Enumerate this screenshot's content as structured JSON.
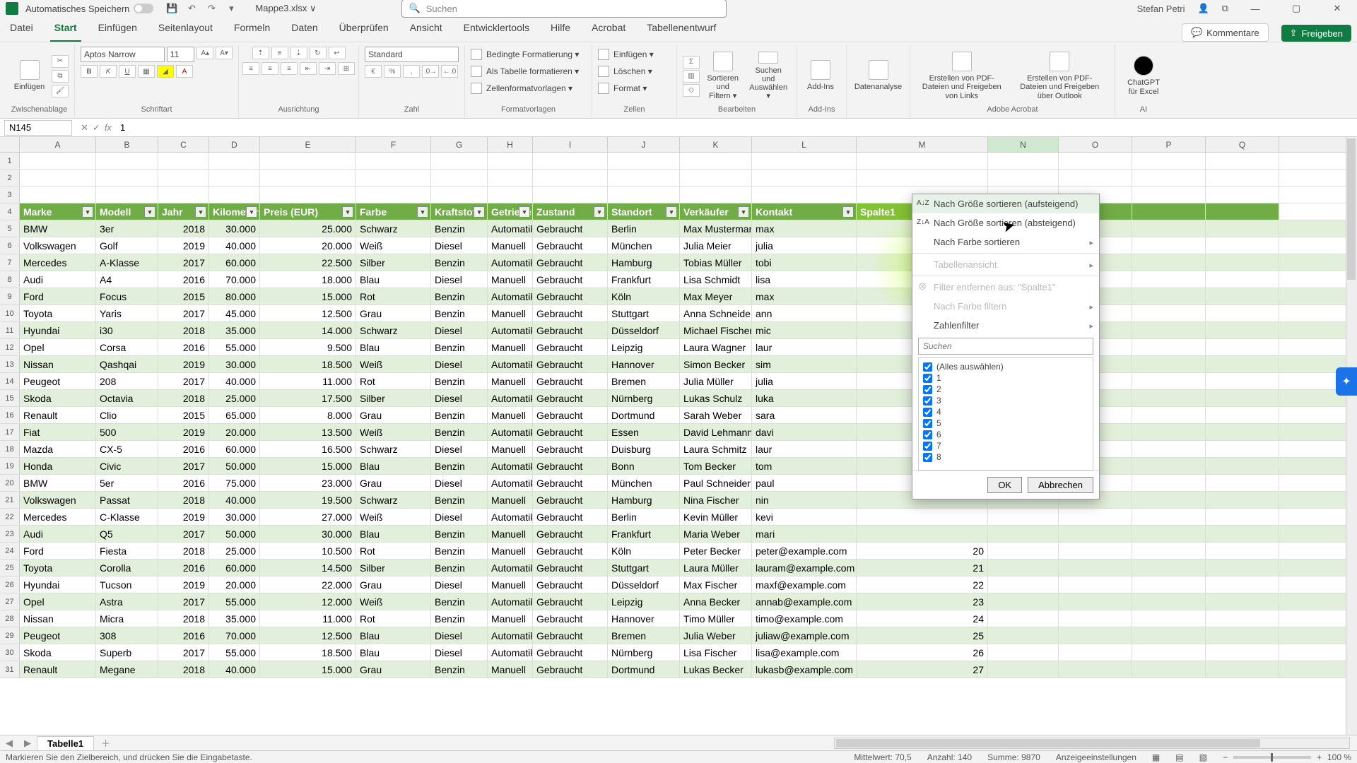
{
  "titlebar": {
    "autosave_label": "Automatisches Speichern",
    "filename": "Mappe3.xlsx ∨",
    "search_placeholder": "Suchen",
    "user": "Stefan Petri"
  },
  "tabs": {
    "items": [
      "Datei",
      "Start",
      "Einfügen",
      "Seitenlayout",
      "Formeln",
      "Daten",
      "Überprüfen",
      "Ansicht",
      "Entwicklertools",
      "Hilfe",
      "Acrobat",
      "Tabellenentwurf"
    ],
    "active_index": 1,
    "comments": "Kommentare",
    "share": "Freigeben"
  },
  "ribbon": {
    "clipboard": {
      "paste": "Einfügen",
      "label": "Zwischenablage"
    },
    "font": {
      "name": "Aptos Narrow",
      "size": "11",
      "label": "Schriftart"
    },
    "align": {
      "label": "Ausrichtung"
    },
    "number": {
      "format": "Standard",
      "label": "Zahl"
    },
    "styles": {
      "cond": "Bedingte Formatierung ▾",
      "tbl": "Als Tabelle formatieren ▾",
      "cell": "Zellenformatvorlagen ▾",
      "label": "Formatvorlagen"
    },
    "cells": {
      "ins": "Einfügen ▾",
      "del": "Löschen ▾",
      "fmt": "Format ▾",
      "label": "Zellen"
    },
    "edit": {
      "sort": "Sortieren und Filtern ▾",
      "find": "Suchen und Auswählen ▾",
      "label": "Bearbeiten"
    },
    "addins": {
      "btn": "Add-Ins",
      "label": "Add-Ins"
    },
    "data": {
      "btn": "Datenanalyse"
    },
    "acrobat": {
      "a": "Erstellen von PDF-Dateien und Freigeben von Links",
      "b": "Erstellen von PDF-Dateien und Freigeben über Outlook",
      "label": "Adobe Acrobat"
    },
    "ai": {
      "btn": "ChatGPT für Excel",
      "label": "AI"
    }
  },
  "formula_bar": {
    "namebox": "N145",
    "value": "1"
  },
  "columns": {
    "letters": [
      "A",
      "B",
      "C",
      "D",
      "E",
      "F",
      "G",
      "H",
      "I",
      "J",
      "K",
      "L",
      "M",
      "N",
      "O",
      "P",
      "Q"
    ],
    "widths": [
      28,
      108,
      88,
      72,
      72,
      136,
      106,
      80,
      64,
      106,
      102,
      102,
      148,
      186,
      100,
      104,
      104,
      104
    ],
    "headers": [
      "Marke",
      "Modell",
      "Jahr",
      "Kilometerstand",
      "Preis (EUR)",
      "Farbe",
      "Kraftstoff",
      "Getriebe",
      "Zustand",
      "Standort",
      "Verkäufer",
      "Kontakt",
      "Spalte1"
    ]
  },
  "rows_blank": 3,
  "table_data": [
    [
      "BMW",
      "3er",
      "2018",
      "30.000",
      "25.000",
      "Schwarz",
      "Benzin",
      "Automatik",
      "Gebraucht",
      "Berlin",
      "Max Mustermann",
      "max",
      "",
      ""
    ],
    [
      "Volkswagen",
      "Golf",
      "2019",
      "40.000",
      "20.000",
      "Weiß",
      "Diesel",
      "Manuell",
      "Gebraucht",
      "München",
      "Julia Meier",
      "julia",
      "",
      ""
    ],
    [
      "Mercedes",
      "A-Klasse",
      "2017",
      "60.000",
      "22.500",
      "Silber",
      "Benzin",
      "Automatik",
      "Gebraucht",
      "Hamburg",
      "Tobias Müller",
      "tobi",
      "",
      ""
    ],
    [
      "Audi",
      "A4",
      "2016",
      "70.000",
      "18.000",
      "Blau",
      "Diesel",
      "Manuell",
      "Gebraucht",
      "Frankfurt",
      "Lisa Schmidt",
      "lisa",
      "",
      ""
    ],
    [
      "Ford",
      "Focus",
      "2015",
      "80.000",
      "15.000",
      "Rot",
      "Benzin",
      "Automatik",
      "Gebraucht",
      "Köln",
      "Max Meyer",
      "max",
      "",
      ""
    ],
    [
      "Toyota",
      "Yaris",
      "2017",
      "45.000",
      "12.500",
      "Grau",
      "Benzin",
      "Manuell",
      "Gebraucht",
      "Stuttgart",
      "Anna Schneider",
      "ann",
      "",
      ""
    ],
    [
      "Hyundai",
      "i30",
      "2018",
      "35.000",
      "14.000",
      "Schwarz",
      "Diesel",
      "Automatik",
      "Gebraucht",
      "Düsseldorf",
      "Michael Fischer",
      "mic",
      "",
      ""
    ],
    [
      "Opel",
      "Corsa",
      "2016",
      "55.000",
      "9.500",
      "Blau",
      "Benzin",
      "Manuell",
      "Gebraucht",
      "Leipzig",
      "Laura Wagner",
      "laur",
      "",
      ""
    ],
    [
      "Nissan",
      "Qashqai",
      "2019",
      "30.000",
      "18.500",
      "Weiß",
      "Diesel",
      "Automatik",
      "Gebraucht",
      "Hannover",
      "Simon Becker",
      "sim",
      "",
      ""
    ],
    [
      "Peugeot",
      "208",
      "2017",
      "40.000",
      "11.000",
      "Rot",
      "Benzin",
      "Manuell",
      "Gebraucht",
      "Bremen",
      "Julia Müller",
      "julia",
      "",
      ""
    ],
    [
      "Skoda",
      "Octavia",
      "2018",
      "25.000",
      "17.500",
      "Silber",
      "Diesel",
      "Automatik",
      "Gebraucht",
      "Nürnberg",
      "Lukas Schulz",
      "luka",
      "",
      ""
    ],
    [
      "Renault",
      "Clio",
      "2015",
      "65.000",
      "8.000",
      "Grau",
      "Benzin",
      "Manuell",
      "Gebraucht",
      "Dortmund",
      "Sarah Weber",
      "sara",
      "",
      ""
    ],
    [
      "Fiat",
      "500",
      "2019",
      "20.000",
      "13.500",
      "Weiß",
      "Benzin",
      "Automatik",
      "Gebraucht",
      "Essen",
      "David Lehmann",
      "davi",
      "",
      ""
    ],
    [
      "Mazda",
      "CX-5",
      "2016",
      "60.000",
      "16.500",
      "Schwarz",
      "Diesel",
      "Manuell",
      "Gebraucht",
      "Duisburg",
      "Laura Schmitz",
      "laur",
      "",
      ""
    ],
    [
      "Honda",
      "Civic",
      "2017",
      "50.000",
      "15.000",
      "Blau",
      "Benzin",
      "Automatik",
      "Gebraucht",
      "Bonn",
      "Tom Becker",
      "tom",
      "",
      ""
    ],
    [
      "BMW",
      "5er",
      "2016",
      "75.000",
      "23.000",
      "Grau",
      "Diesel",
      "Automatik",
      "Gebraucht",
      "München",
      "Paul Schneider",
      "paul",
      "",
      ""
    ],
    [
      "Volkswagen",
      "Passat",
      "2018",
      "40.000",
      "19.500",
      "Schwarz",
      "Benzin",
      "Manuell",
      "Gebraucht",
      "Hamburg",
      "Nina Fischer",
      "nin",
      "",
      ""
    ],
    [
      "Mercedes",
      "C-Klasse",
      "2019",
      "30.000",
      "27.000",
      "Weiß",
      "Diesel",
      "Automatik",
      "Gebraucht",
      "Berlin",
      "Kevin Müller",
      "kevi",
      "",
      ""
    ],
    [
      "Audi",
      "Q5",
      "2017",
      "50.000",
      "30.000",
      "Blau",
      "Benzin",
      "Manuell",
      "Gebraucht",
      "Frankfurt",
      "Maria Weber",
      "mari",
      "",
      ""
    ],
    [
      "Ford",
      "Fiesta",
      "2018",
      "25.000",
      "10.500",
      "Rot",
      "Benzin",
      "Manuell",
      "Gebraucht",
      "Köln",
      "Peter Becker",
      "peter@example.com",
      "20",
      ""
    ],
    [
      "Toyota",
      "Corolla",
      "2016",
      "60.000",
      "14.500",
      "Silber",
      "Benzin",
      "Automatik",
      "Gebraucht",
      "Stuttgart",
      "Laura Müller",
      "lauram@example.com",
      "21",
      ""
    ],
    [
      "Hyundai",
      "Tucson",
      "2019",
      "20.000",
      "22.000",
      "Grau",
      "Diesel",
      "Manuell",
      "Gebraucht",
      "Düsseldorf",
      "Max Fischer",
      "maxf@example.com",
      "22",
      ""
    ],
    [
      "Opel",
      "Astra",
      "2017",
      "55.000",
      "12.000",
      "Weiß",
      "Benzin",
      "Automatik",
      "Gebraucht",
      "Leipzig",
      "Anna Becker",
      "annab@example.com",
      "23",
      ""
    ],
    [
      "Nissan",
      "Micra",
      "2018",
      "35.000",
      "11.000",
      "Rot",
      "Benzin",
      "Manuell",
      "Gebraucht",
      "Hannover",
      "Timo Müller",
      "timo@example.com",
      "24",
      ""
    ],
    [
      "Peugeot",
      "308",
      "2016",
      "70.000",
      "12.500",
      "Blau",
      "Diesel",
      "Automatik",
      "Gebraucht",
      "Bremen",
      "Julia Weber",
      "juliaw@example.com",
      "25",
      ""
    ],
    [
      "Skoda",
      "Superb",
      "2017",
      "55.000",
      "18.500",
      "Blau",
      "Diesel",
      "Automatik",
      "Gebraucht",
      "Nürnberg",
      "Lisa Fischer",
      "lisa@example.com",
      "26",
      ""
    ],
    [
      "Renault",
      "Megane",
      "2018",
      "40.000",
      "15.000",
      "Grau",
      "Benzin",
      "Manuell",
      "Gebraucht",
      "Dortmund",
      "Lukas Becker",
      "lukasb@example.com",
      "27",
      ""
    ]
  ],
  "filter_dropdown": {
    "sort_asc": "Nach Größe sortieren (aufsteigend)",
    "sort_desc": "Nach Größe sortieren (absteigend)",
    "sort_color": "Nach Farbe sortieren",
    "tableview": "Tabellenansicht",
    "clear": "Filter entfernen aus: \"Spalte1\"",
    "filter_color": "Nach Farbe filtern",
    "num_filter": "Zahlenfilter",
    "search_ph": "Suchen",
    "select_all": "(Alles auswählen)",
    "items": [
      "1",
      "2",
      "3",
      "4",
      "5",
      "6",
      "7",
      "8"
    ],
    "ok": "OK",
    "cancel": "Abbrechen"
  },
  "sheet": {
    "name": "Tabelle1"
  },
  "status": {
    "hint": "Markieren Sie den Zielbereich, und drücken Sie die Eingabetaste.",
    "avg": "Mittelwert: 70,5",
    "count": "Anzahl: 140",
    "sum": "Summe: 9870",
    "display": "Anzeigeeinstellungen",
    "zoom": "100 %"
  }
}
